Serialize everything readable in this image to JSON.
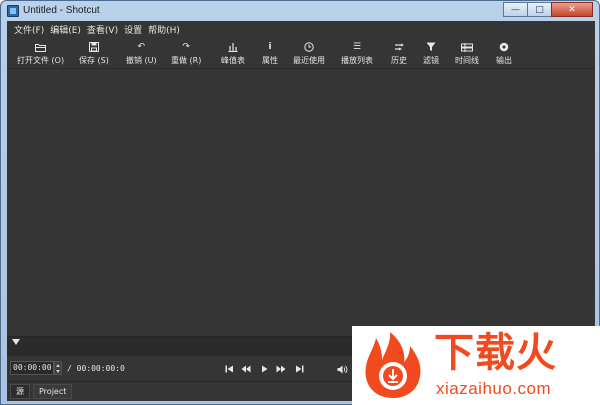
{
  "window": {
    "title": "Untitled - Shotcut",
    "buttons": {
      "minimize": "—",
      "maximize": "□",
      "close": "✕"
    }
  },
  "menubar": {
    "items": [
      {
        "label": "文件(F)"
      },
      {
        "label": "编辑(E)"
      },
      {
        "label": "查看(V)"
      },
      {
        "label": "设置"
      },
      {
        "label": "帮助(H)"
      }
    ]
  },
  "toolbar": {
    "items": [
      {
        "label": "打开文件 (O)",
        "icon": "folder-open-icon"
      },
      {
        "label": "保存 (S)",
        "icon": "save-icon"
      },
      {
        "label": "撤销 (U)",
        "icon": "undo-icon"
      },
      {
        "label": "重做 (R)",
        "icon": "redo-icon"
      },
      {
        "label": "峰值表",
        "icon": "peak-meter-icon"
      },
      {
        "label": "属性",
        "icon": "info-icon"
      },
      {
        "label": "最近使用",
        "icon": "clock-icon"
      },
      {
        "label": "播放列表",
        "icon": "list-icon"
      },
      {
        "label": "历史",
        "icon": "history-icon"
      },
      {
        "label": "滤镜",
        "icon": "filter-icon"
      },
      {
        "label": "时间线",
        "icon": "timeline-icon"
      },
      {
        "label": "输出",
        "icon": "export-icon"
      }
    ]
  },
  "transport": {
    "position": "00:00:00:0",
    "duration": "/ 00:00:00:0",
    "buttons": [
      "skip-to-start-icon",
      "rewind-icon",
      "play-icon",
      "fast-forward-icon",
      "skip-to-end-icon",
      "volume-icon"
    ]
  },
  "tabs": [
    {
      "label": "源"
    },
    {
      "label": "Project"
    }
  ],
  "watermark": {
    "main": "下载火",
    "sub": "xiazaihuo.com",
    "color": "#f04a1e"
  }
}
